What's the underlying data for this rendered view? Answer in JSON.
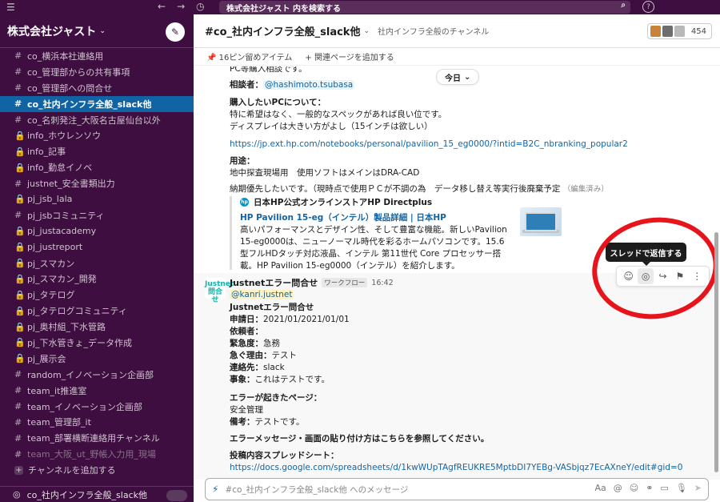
{
  "topbar": {
    "menu_icon": "☰",
    "back_icon": "←",
    "forward_icon": "→",
    "history_icon": "◷",
    "search_placeholder": "株式会社ジャスト 内を検索する",
    "help_icon": "?"
  },
  "workspace": {
    "name": "株式会社ジャスト",
    "caret": "⌄",
    "compose_icon": "✎"
  },
  "sidebar": {
    "channels": [
      {
        "prefix": "#",
        "label": "co_横浜本社連絡用",
        "state": "normal"
      },
      {
        "prefix": "#",
        "label": "co_管理部からの共有事項",
        "state": "normal"
      },
      {
        "prefix": "#",
        "label": "co_管理部への問合せ",
        "state": "normal"
      },
      {
        "prefix": "#",
        "label": "co_社内インフラ全般_slack他",
        "state": "active"
      },
      {
        "prefix": "#",
        "label": "co_名刺発注_大阪名古屋仙台以外",
        "state": "normal"
      },
      {
        "prefix": "🔒",
        "label": "info_ホウレンソウ",
        "state": "normal"
      },
      {
        "prefix": "🔒",
        "label": "info_記事",
        "state": "normal"
      },
      {
        "prefix": "🔒",
        "label": "info_勤怠イノベ",
        "state": "normal"
      },
      {
        "prefix": "#",
        "label": "justnet_安全書類出力",
        "state": "normal"
      },
      {
        "prefix": "🔒",
        "label": "pj_jsb_lala",
        "state": "normal"
      },
      {
        "prefix": "#",
        "label": "pj_jsbコミュニティ",
        "state": "normal"
      },
      {
        "prefix": "🔒",
        "label": "pj_justacademy",
        "state": "normal"
      },
      {
        "prefix": "🔒",
        "label": "pj_justreport",
        "state": "normal"
      },
      {
        "prefix": "🔒",
        "label": "pj_スマカン",
        "state": "normal"
      },
      {
        "prefix": "🔒",
        "label": "pj_スマカン_開発",
        "state": "normal"
      },
      {
        "prefix": "🔒",
        "label": "pj_タテログ",
        "state": "normal"
      },
      {
        "prefix": "🔒",
        "label": "pj_タテログコミュニティ",
        "state": "normal"
      },
      {
        "prefix": "🔒",
        "label": "pj_奥村組_下水管路",
        "state": "normal"
      },
      {
        "prefix": "🔒",
        "label": "pj_下水管きょ_データ作成",
        "state": "normal"
      },
      {
        "prefix": "🔒",
        "label": "pj_展示会",
        "state": "normal"
      },
      {
        "prefix": "#",
        "label": "random_イノベーション企画部",
        "state": "normal"
      },
      {
        "prefix": "#",
        "label": "team_it推進室",
        "state": "normal"
      },
      {
        "prefix": "#",
        "label": "team_イノベーション企画部",
        "state": "normal"
      },
      {
        "prefix": "#",
        "label": "team_管理部_it",
        "state": "normal"
      },
      {
        "prefix": "#",
        "label": "team_部署横断連絡用チャンネル",
        "state": "normal"
      },
      {
        "prefix": "#",
        "label": "team_大阪_ut_野帳入力用_現場",
        "state": "muted"
      },
      {
        "prefix": "+",
        "label": "チャンネルを追加する",
        "state": "add"
      }
    ],
    "bottom_label": "co_社内インフラ全般_slack他",
    "bottom_icon": "◎"
  },
  "channel": {
    "title": "#co_社内インフラ全般_slack他",
    "caret": "⌄",
    "topic": "社内インフラ全般のチャンネル",
    "member_count": "454",
    "pinned": "16ピン留めアイテム",
    "add_page": "関連ページを追加する",
    "pin_icon": "📌",
    "plus_icon": "+"
  },
  "today_pill": {
    "label": "今日",
    "caret": "⌄"
  },
  "message1": {
    "line0": "PC等購入相談です。",
    "consult_label": "相談者：",
    "consult_user": "@hashimoto.tsubasa",
    "pc_heading": "購入したいPCについて：",
    "pc_line1": "特に希望はなく、一般的なスペックがあれば良い位です。",
    "pc_line2": "ディスプレイは大きい方がよし（15インチは欲しい）",
    "url": "https://jp.ext.hp.com/notebooks/personal/pavilion_15_eg0000/?intid=B2C_nbranking_popular2",
    "usage_label": "用途：",
    "usage_text": "地中探査現場用　使用ソフトはメインはDRA-CAD",
    "delivery_text": "納期優先したいです。（現時点で使用ＰＣが不調の為　データ移し替え等実行後廃棄予定",
    "edited": "（編集済み）"
  },
  "unfurl": {
    "site": "日本HP公式オンラインストアHP Directplus",
    "title": "HP Pavilion 15-eg（インテル）製品詳細 | 日本HP",
    "description": "高いパフォーマンスとデザイン性、そして豊富な機能。新しいPavilion 15-eg0000は、ニューノーマル時代を彩るホームパソコンです。15.6型フルHDタッチ対応液晶、インテル 第11世代 Core プロセッサー搭載。HP Pavilion 15-eg0000（インテル）を紹介します。"
  },
  "message2": {
    "avatar_text": "Justnet問合せ",
    "sender": "Justnetエラー問合せ",
    "tag": "ワークフロー",
    "time": "16:42",
    "mention": "@kanri.justnet",
    "heading": "Justnetエラー問合せ",
    "fields": [
      {
        "label": "申請日：",
        "value": "2021/01/2021/01/01"
      },
      {
        "label": "依頼者：",
        "value": ""
      },
      {
        "label": "緊急度：",
        "value": "急務"
      },
      {
        "label": "急ぐ理由：",
        "value": "テスト"
      },
      {
        "label": "連絡先：",
        "value": "slack"
      },
      {
        "label": "事象：",
        "value": "これはテストです。"
      }
    ],
    "error_page_label": "エラーが起きたページ：",
    "error_page_value": "安全管理",
    "notes_label": "備考：",
    "notes_value": "テストです。",
    "screenshot_note": "エラーメッセージ・画面の貼り付け方はこちらを参照してください。",
    "spreadsheet_label": "投稿内容スプレッドシート：",
    "spreadsheet_url": "https://docs.google.com/spreadsheets/d/1kwWUpTAgfREUKRE5MptbDI7YEBg-VASbjqz7EcAXneY/edit#gid=0"
  },
  "hover_actions": {
    "tooltip": "スレッドで返信する",
    "icons": [
      "emoji-icon",
      "thread-reply-icon",
      "share-icon",
      "bookmark-icon",
      "more-icon"
    ]
  },
  "composer": {
    "placeholder": "#co_社内インフラ全般_slack他 へのメッセージ",
    "aa": "Aa",
    "at": "@",
    "emoji": "☺",
    "attach": "⚭",
    "video": "▭",
    "mic": "🎙",
    "send": "➤"
  }
}
